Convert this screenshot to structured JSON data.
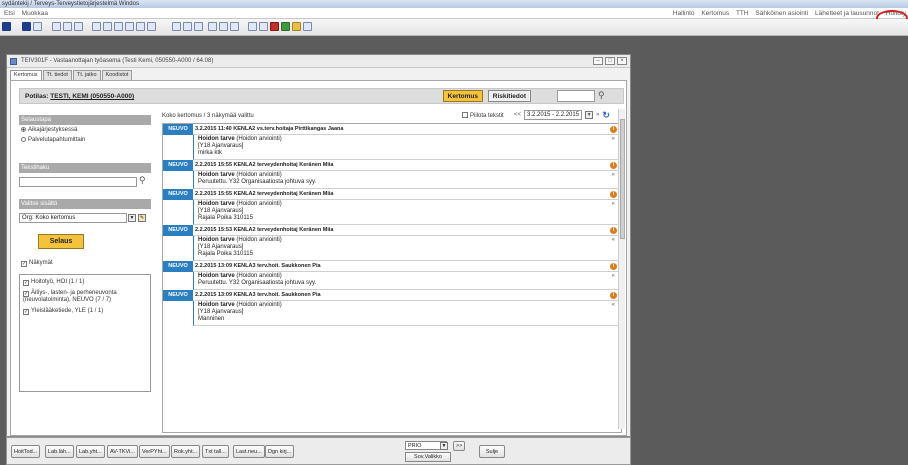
{
  "window_title": "sydäntekij / Terveys-Terveystietojärjestelmä Windos",
  "menu": {
    "left": [
      "Etsi",
      "Muokkaa"
    ],
    "right": [
      "Hallinto",
      "Kertomus",
      "TTH",
      "Sähköinen asiointi",
      "Lähetteet ja lausunnot",
      "Hoitoty"
    ]
  },
  "form": {
    "title": "TEIV301F - Vastaanottajan työasema  (Testi Kemi, 050550-A000 / 64.08)",
    "tabs": [
      "Kertomus",
      "Tt. tiedot",
      "Tt. jatko",
      "Koodistot"
    ],
    "patient_label": "Potilas:",
    "patient_name": "TESTI, KEMI (050550-A000)",
    "btn_kertomus": "Kertomus",
    "btn_riskitiedot": "Riskitiedot"
  },
  "sidebar": {
    "selaustapa": "Selaustapa",
    "radio1": "Aikajärjestyksessä",
    "radio2": "Palvelutapahtumittain",
    "tekstihaku": "Tekstihaku",
    "valitse": "Valitse sisältö",
    "org_value": "Org: Koko kertomus",
    "selaus_btn": "Selaus",
    "nakymat": "Näkymät",
    "views": [
      "Hoitotyö, HOI (1 / 1)",
      "Äitiys-, lasten- ja perheneuvonta (neuvolatoiminta), NEUVO (7 / 7)",
      "Yleislääketiede, YLE (1 / 1)"
    ]
  },
  "content": {
    "summary": "Koko kertomus / 3 näkymää valittu",
    "piilota": "Piilota tekstit",
    "prev": "<<",
    "next": "»",
    "date_range": "3.2.2015 - 2.2.2015",
    "entries": [
      {
        "tag": "NEUVO",
        "header": "3.2.2015 11:40 KENLA2 vs.terv.hoitaja Pirttikangas Jaana",
        "title": "Hoidon tarve",
        "sub": "(Hoidon arviointi)",
        "lines": [
          "[Y18 Ajanvaraus]",
          "mirka ktk"
        ]
      },
      {
        "tag": "NEUVO",
        "header": "2.2.2015 15:55 KENLA2 terveydenhoitaj Keränen Miia",
        "title": "Hoidon tarve",
        "sub": "(Hoidon arviointi)",
        "lines": [
          "Peruutettu. Y32 Organisaatiosta johtuva syy."
        ]
      },
      {
        "tag": "NEUVO",
        "header": "2.2.2015 15:55 KENLA2 terveydenhoitaj Keränen Miia",
        "title": "Hoidon tarve",
        "sub": "(Hoidon arviointi)",
        "lines": [
          "[Y18 Ajanvaraus]",
          "Rajala Poika 310115"
        ]
      },
      {
        "tag": "NEUVO",
        "header": "2.2.2015 15:53 KENLA2 terveydenhoitaj Keränen Miia",
        "title": "Hoidon tarve",
        "sub": "(Hoidon arviointi)",
        "lines": [
          "[Y18 Ajanvaraus]",
          "Rajala Poika 310115"
        ]
      },
      {
        "tag": "NEUVO",
        "header": "2.2.2015 13:09 KENLA3 terv.hoit. Saukkonen Pia",
        "title": "Hoidon tarve",
        "sub": "(Hoidon arviointi)",
        "lines": [
          "Peruutettu. Y32 Organisaatiosta johtuva syy."
        ]
      },
      {
        "tag": "NEUVO",
        "header": "2.2.2015 13:09 KENLA3 terv.hoit. Saukkonen Pia",
        "title": "Hoidon tarve",
        "sub": "(Hoidon arviointi)",
        "lines": [
          "[Y18 Ajanvaraus]",
          "Manninen"
        ]
      }
    ]
  },
  "bottom": {
    "buttons": [
      "HoitTod...",
      "Lab.läh...",
      "Lab.yht...",
      "AV-TKVi...",
      "VerPYht...",
      "Rok.yht...",
      "Txt tall...",
      "Last.neu...",
      "Dgn kirj..."
    ],
    "prio": "PRIO",
    "sov": "Sov.Valikko",
    "sulje": "Sulje",
    "more": ">>"
  }
}
